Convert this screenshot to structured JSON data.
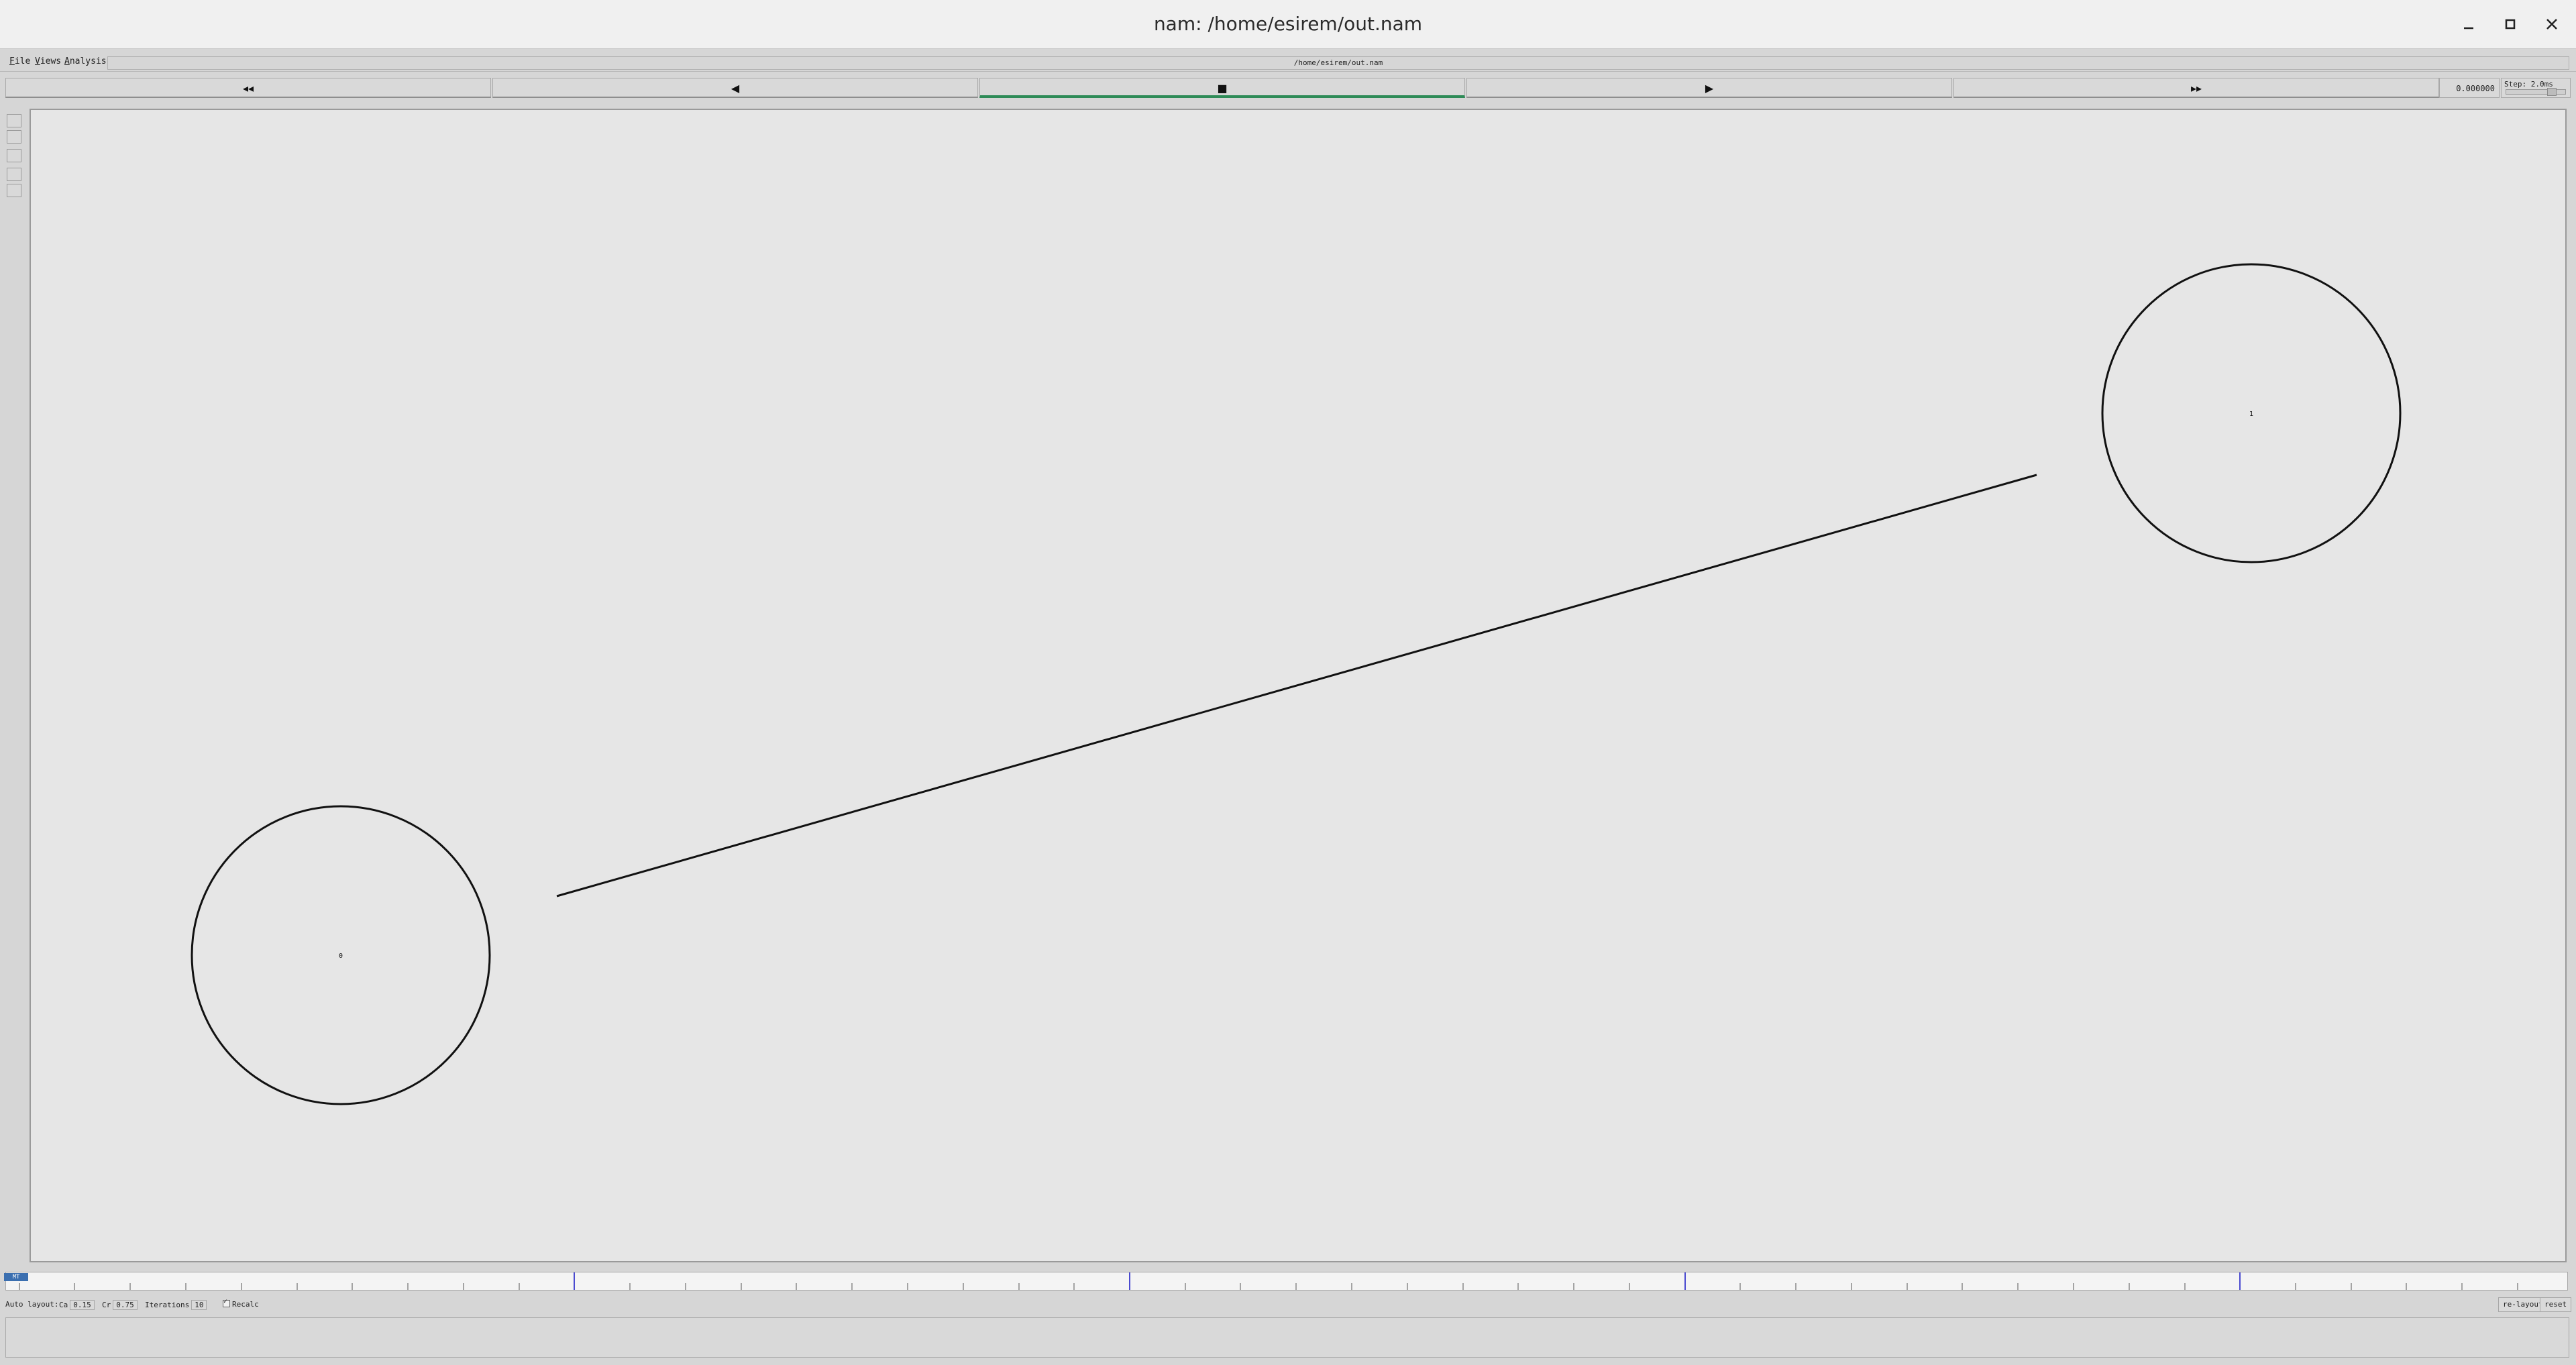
{
  "window": {
    "title": "nam: /home/esirem/out.nam",
    "controls": [
      "minimize-icon",
      "maximize-icon",
      "close-icon"
    ]
  },
  "menubar": {
    "items": [
      {
        "label": "File",
        "underline": "F",
        "rest": "ile"
      },
      {
        "label": "Views",
        "underline": "V",
        "rest": "iews"
      },
      {
        "label": "Analysis",
        "underline": "A",
        "rest": "nalysis"
      }
    ],
    "filepath": "/home/esirem/out.nam"
  },
  "controls": {
    "rewind_glyph": "◂◂",
    "back_glyph": "◀",
    "stop_glyph": "■",
    "play_glyph": "▶",
    "fastforward_glyph": "▸▸",
    "time": "0.000000",
    "step_label": "Step: 2.0ms"
  },
  "canvas": {
    "nodes": [
      {
        "id": "0",
        "label": "0"
      },
      {
        "id": "1",
        "label": "1"
      }
    ],
    "link": {
      "from": "0",
      "to": "1"
    }
  },
  "timeline": {
    "marker_label": "MT"
  },
  "layout": {
    "auto_layout_label": "Auto layout:",
    "ca_label": "Ca",
    "ca_value": "0.15",
    "cr_label": "Cr",
    "cr_value": "0.75",
    "iterations_label": "Iterations",
    "iterations_value": "10",
    "recalc_label": "Recalc",
    "relayout_button": "re-layout",
    "reset_button": "reset"
  }
}
